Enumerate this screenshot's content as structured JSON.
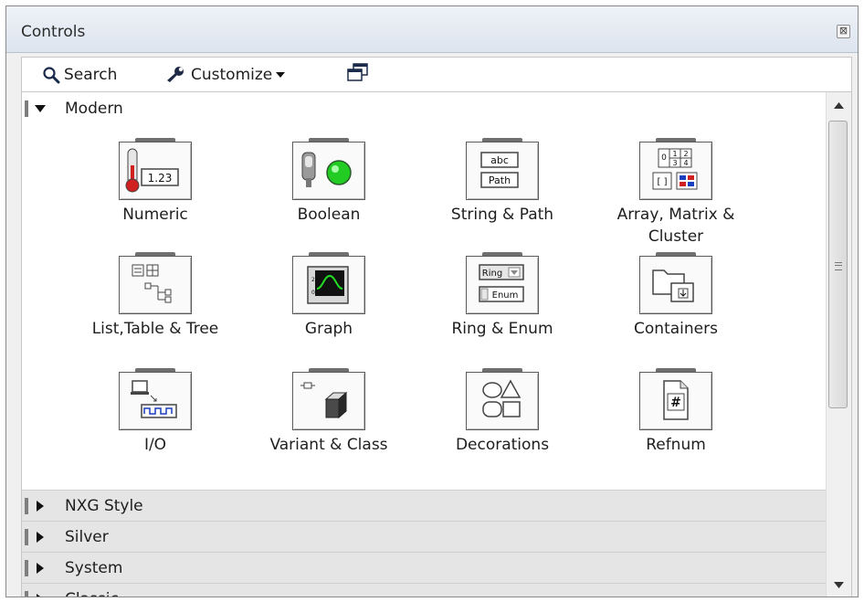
{
  "window": {
    "title": "Controls",
    "close_glyph": "⊠"
  },
  "toolbar": {
    "search_label": "Search",
    "customize_label": "Customize",
    "search_icon": "magnifier-icon",
    "customize_icon": "wrench-icon",
    "pin_icon": "palette-window-icon"
  },
  "categories": [
    {
      "label": "Modern",
      "expanded": true,
      "items": [
        {
          "label": "Numeric",
          "icon": "numeric-icon"
        },
        {
          "label": "Boolean",
          "icon": "boolean-icon"
        },
        {
          "label": "String & Path",
          "icon": "string-path-icon"
        },
        {
          "label": "Array, Matrix & Cluster",
          "icon": "array-matrix-cluster-icon"
        },
        {
          "label": "List,Table & Tree",
          "icon": "list-table-tree-icon"
        },
        {
          "label": "Graph",
          "icon": "graph-icon"
        },
        {
          "label": "Ring & Enum",
          "icon": "ring-enum-icon"
        },
        {
          "label": "Containers",
          "icon": "containers-icon"
        },
        {
          "label": "I/O",
          "icon": "io-icon"
        },
        {
          "label": "Variant & Class",
          "icon": "variant-class-icon"
        },
        {
          "label": "Decorations",
          "icon": "decorations-icon"
        },
        {
          "label": "Refnum",
          "icon": "refnum-icon"
        }
      ]
    },
    {
      "label": "NXG Style",
      "expanded": false
    },
    {
      "label": "Silver",
      "expanded": false
    },
    {
      "label": "System",
      "expanded": false
    },
    {
      "label": "Classic",
      "expanded": false
    }
  ],
  "icon_text": {
    "numeric_value": "1.23",
    "string_abc": "abc",
    "string_path": "Path",
    "ring": "Ring",
    "enum": "Enum",
    "refnum": "#"
  },
  "colors": {
    "collapsed_bg": "#e5e5e5",
    "boolean_led": "#22cc22",
    "thermometer": "#d02020"
  }
}
